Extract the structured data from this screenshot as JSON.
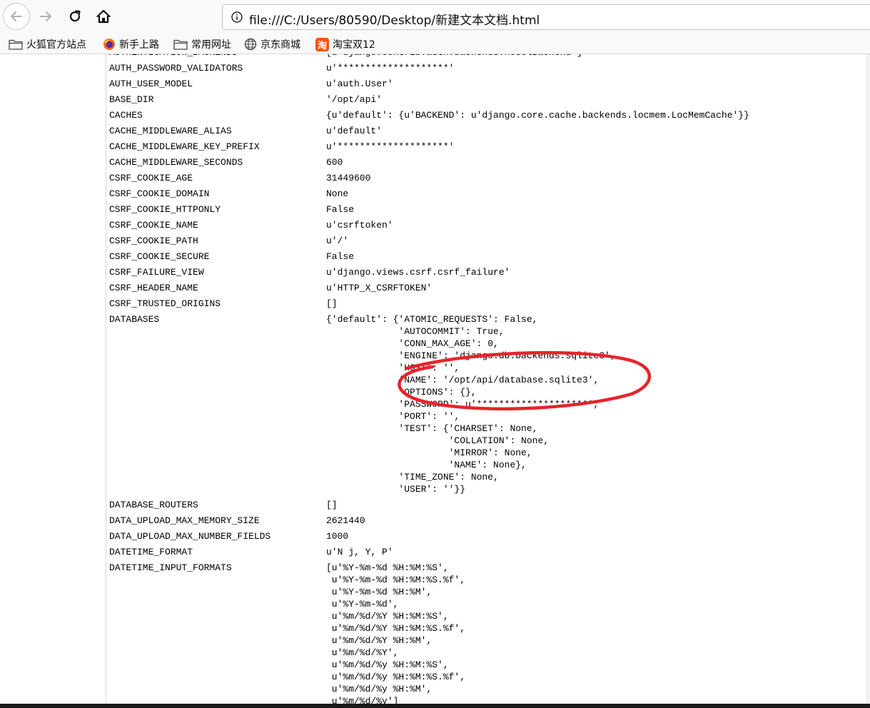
{
  "browser": {
    "url": "file:///C:/Users/80590/Desktop/新建文本文档.html",
    "bookmarks": [
      {
        "label": "火狐官方站点",
        "icon": "folder-icon"
      },
      {
        "label": "新手上路",
        "icon": "firefox-icon"
      },
      {
        "label": "常用网址",
        "icon": "folder-icon"
      },
      {
        "label": "京东商城",
        "icon": "globe-icon"
      },
      {
        "label": "淘宝双12",
        "icon": "taobao-icon"
      }
    ],
    "taobao_glyph": "淘"
  },
  "settings": [
    {
      "key": "AUTHENTICATION_BACKENDS",
      "value": "[u'django.contrib.auth.backends.ModelBackend']"
    },
    {
      "key": "AUTH_PASSWORD_VALIDATORS",
      "value": "u'********************'"
    },
    {
      "key": "AUTH_USER_MODEL",
      "value": "u'auth.User'"
    },
    {
      "key": "BASE_DIR",
      "value": "'/opt/api'"
    },
    {
      "key": "CACHES",
      "value": "{u'default': {u'BACKEND': u'django.core.cache.backends.locmem.LocMemCache'}}"
    },
    {
      "key": "CACHE_MIDDLEWARE_ALIAS",
      "value": "u'default'"
    },
    {
      "key": "CACHE_MIDDLEWARE_KEY_PREFIX",
      "value": "u'********************'"
    },
    {
      "key": "CACHE_MIDDLEWARE_SECONDS",
      "value": "600"
    },
    {
      "key": "CSRF_COOKIE_AGE",
      "value": "31449600"
    },
    {
      "key": "CSRF_COOKIE_DOMAIN",
      "value": "None"
    },
    {
      "key": "CSRF_COOKIE_HTTPONLY",
      "value": "False"
    },
    {
      "key": "CSRF_COOKIE_NAME",
      "value": "u'csrftoken'"
    },
    {
      "key": "CSRF_COOKIE_PATH",
      "value": "u'/'"
    },
    {
      "key": "CSRF_COOKIE_SECURE",
      "value": "False"
    },
    {
      "key": "CSRF_FAILURE_VIEW",
      "value": "u'django.views.csrf.csrf_failure'"
    },
    {
      "key": "CSRF_HEADER_NAME",
      "value": "u'HTTP_X_CSRFTOKEN'"
    },
    {
      "key": "CSRF_TRUSTED_ORIGINS",
      "value": "[]"
    },
    {
      "key": "DATABASES",
      "value": "{'default': {'ATOMIC_REQUESTS': False,\n             'AUTOCOMMIT': True,\n             'CONN_MAX_AGE': 0,\n             'ENGINE': 'django.db.backends.sqlite3',\n             'HOST': '',\n             'NAME': '/opt/api/database.sqlite3',\n             'OPTIONS': {},\n             'PASSWORD': u'********************',\n             'PORT': '',\n             'TEST': {'CHARSET': None,\n                      'COLLATION': None,\n                      'MIRROR': None,\n                      'NAME': None},\n             'TIME_ZONE': None,\n             'USER': ''}}"
    },
    {
      "key": "DATABASE_ROUTERS",
      "value": "[]"
    },
    {
      "key": "DATA_UPLOAD_MAX_MEMORY_SIZE",
      "value": "2621440"
    },
    {
      "key": "DATA_UPLOAD_MAX_NUMBER_FIELDS",
      "value": "1000"
    },
    {
      "key": "DATETIME_FORMAT",
      "value": "u'N j, Y, P'"
    },
    {
      "key": "DATETIME_INPUT_FORMATS",
      "value": "[u'%Y-%m-%d %H:%M:%S',\n u'%Y-%m-%d %H:%M:%S.%f',\n u'%Y-%m-%d %H:%M',\n u'%Y-%m-%d',\n u'%m/%d/%Y %H:%M:%S',\n u'%m/%d/%Y %H:%M:%S.%f',\n u'%m/%d/%Y %H:%M',\n u'%m/%d/%Y',\n u'%m/%d/%y %H:%M:%S',\n u'%m/%d/%y %H:%M:%S.%f',\n u'%m/%d/%y %H:%M',\n u'%m/%d/%y']"
    }
  ],
  "colors": {
    "annotation": "#e8232a",
    "chrome": "#f9f9fa"
  }
}
